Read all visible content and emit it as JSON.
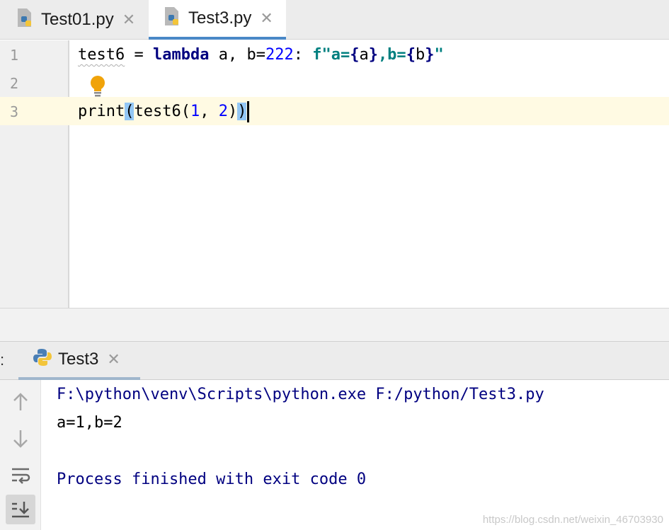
{
  "editor": {
    "tabs": [
      {
        "label": "Test01.py",
        "close": "✕",
        "icon": "python-file-icon"
      },
      {
        "label": "Test3.py",
        "close": "✕",
        "icon": "python-file-icon",
        "active": true
      }
    ],
    "line_numbers": [
      "1",
      "2",
      "3"
    ],
    "code": {
      "line1": {
        "name": "test6",
        "eq": " = ",
        "kw": "lambda",
        "params": " a, b=",
        "default": "222",
        "colon": ": ",
        "fstr_prefix": "f\"a=",
        "fbrace1_open": "{",
        "fvar1": "a",
        "fbrace1_close": "}",
        "fmid": ",b=",
        "fbrace2_open": "{",
        "fvar2": "b",
        "fbrace2_close": "}",
        "fend": "\""
      },
      "line3": {
        "fn": "print",
        "open": "(",
        "call": "test6(",
        "arg1": "1",
        "sep": ", ",
        "arg2": "2",
        "inner_close": ")",
        "outer_close": ")"
      }
    },
    "intention_icon": "lightbulb-icon"
  },
  "run_window": {
    "prefix": ":",
    "tab": {
      "label": "Test3",
      "close": "✕",
      "icon": "python-icon"
    },
    "toolbar": [
      "arrow-up-icon",
      "arrow-down-icon",
      "soft-wrap-icon",
      "scroll-to-end-icon"
    ],
    "console": [
      {
        "text": "F:\\python\\venv\\Scripts\\python.exe F:/python/Test3.py",
        "color": "#000080"
      },
      {
        "text": "a=1,b=2",
        "color": "#000000"
      },
      {
        "text": "",
        "color": "#000000"
      },
      {
        "text": "Process finished with exit code 0",
        "color": "#000080"
      }
    ]
  },
  "watermark": "https://blog.csdn.net/weixin_46703930"
}
